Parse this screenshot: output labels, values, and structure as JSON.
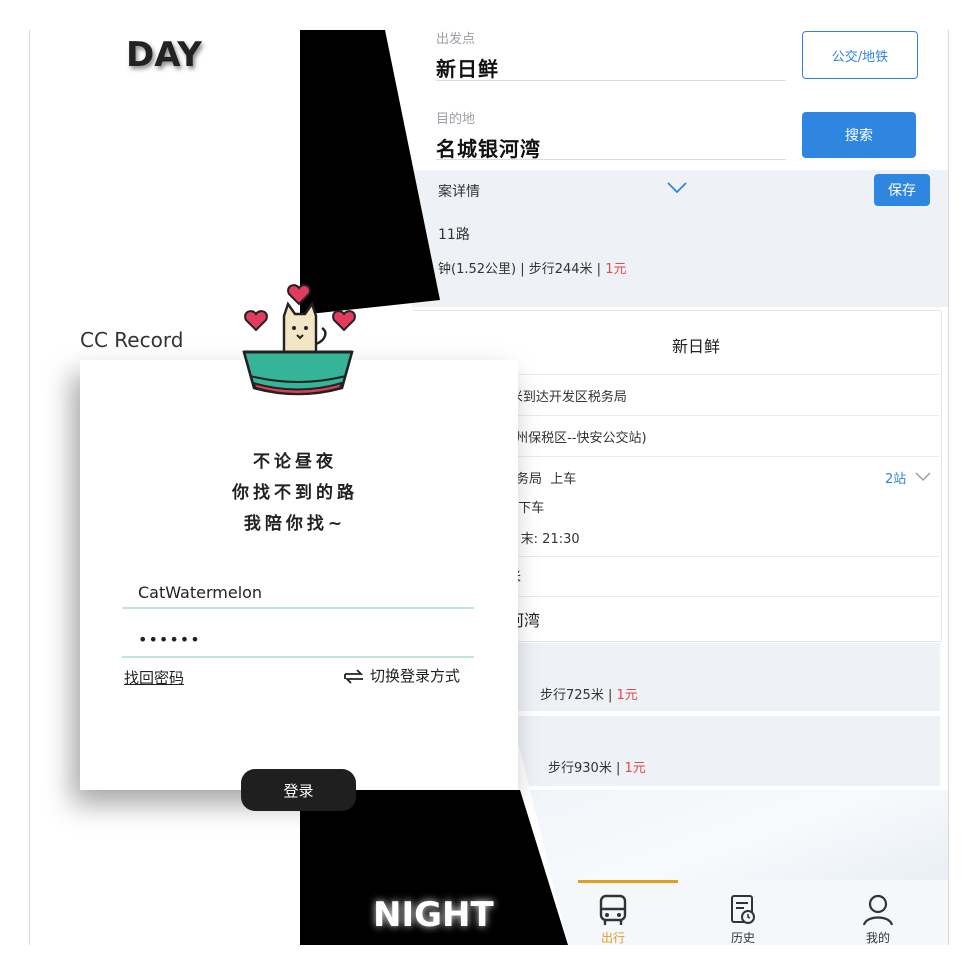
{
  "labels": {
    "day": "DAY",
    "night": "NIGHT"
  },
  "login": {
    "app_name": "CC Record",
    "slogan": [
      "不论昼夜",
      "你找不到的路",
      "我陪你找~"
    ],
    "username": "CatWatermelon",
    "password_mask": "••••••",
    "forgot_password": "找回密码",
    "switch_login": "切换登录方式",
    "login_button": "登录"
  },
  "transit": {
    "origin_label": "出发点",
    "origin": "新日鲜",
    "destination_label": "目的地",
    "destination": "名城银河湾",
    "mode_button": "公交/地铁",
    "search_button": "搜索",
    "plan_detail": "案详情",
    "save_button": "保存",
    "route1": {
      "name": "11路",
      "summary_prefix": "钟(1.52公里) | 步行244米 | ",
      "price": "1元"
    },
    "detail": {
      "start": "新日鲜",
      "step_walk": "行160米到达开发区税务局",
      "step_line": "路(福州保税区--快安公交站)",
      "board_stop": "区税务局",
      "board_label": "上车",
      "stops_count": "2站",
      "alight_stop": "湾",
      "alight_label": "下车",
      "time_range": "30 末: 21:30",
      "walk_frag": "米",
      "end_frag": "河湾"
    },
    "route2": {
      "summary_prefix": "步行725米 | ",
      "price": "1元"
    },
    "route3": {
      "summary_prefix": "步行930米 | ",
      "price": "1元"
    },
    "nav": [
      {
        "label": "出行",
        "active": true
      },
      {
        "label": "历史",
        "active": false
      },
      {
        "label": "我的",
        "active": false
      }
    ],
    "colors": {
      "accent": "#2f86e0",
      "price": "#e04a4a",
      "nav_active": "#e0a020"
    }
  }
}
